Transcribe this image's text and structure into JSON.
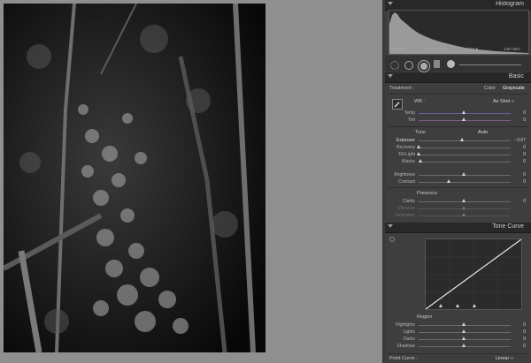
{
  "panels": {
    "histogram": {
      "title": "Histogram",
      "iso": "ISO 80",
      "focal": "6.7 mm",
      "aperture": "f / 2.8",
      "shutter": "1/60 SEC"
    },
    "basic": {
      "title": "Basic",
      "treatment_label": "Treatment :",
      "treatment_options": [
        "Color",
        "Grayscale"
      ],
      "treatment_selected": "Grayscale",
      "wb_label": "WB :",
      "wb_value": "As Shot ÷",
      "temp_label": "Temp",
      "temp_value": "0",
      "tint_label": "Tint",
      "tint_value": "0",
      "tone_label": "Tone",
      "auto_label": "Auto",
      "exposure_label": "Exposure",
      "exposure_value": "- 0.07",
      "recovery_label": "Recovery",
      "recovery_value": "0",
      "fill_label": "Fill Light",
      "fill_value": "0",
      "blacks_label": "Blacks",
      "blacks_value": "0",
      "brightness_label": "Brightness",
      "brightness_value": "0",
      "contrast_label": "Contrast",
      "contrast_value": "0",
      "presence_label": "Presence",
      "clarity_label": "Clarity",
      "clarity_value": "0",
      "vibrance_label": "Vibrance",
      "vibrance_value": "",
      "saturation_label": "Saturation",
      "saturation_value": ""
    },
    "tone_curve": {
      "title": "Tone Curve",
      "region_label": "Region",
      "highlights_label": "Highlights",
      "highlights_value": "0",
      "lights_label": "Lights",
      "lights_value": "0",
      "darks_label": "Darks",
      "darks_value": "0",
      "shadows_label": "Shadows",
      "shadows_value": "0",
      "point_curve_label": "Point Curve :",
      "point_curve_value": "Linear ÷"
    }
  },
  "colors": {
    "panel_bg": "#3e3e3e",
    "header_bg": "#282828",
    "canvas_bg": "#8f8f8f"
  },
  "icons": [
    "crop-icon",
    "spot-removal-icon",
    "red-eye-icon",
    "gradient-icon",
    "brush-icon",
    "eyedropper-icon"
  ]
}
